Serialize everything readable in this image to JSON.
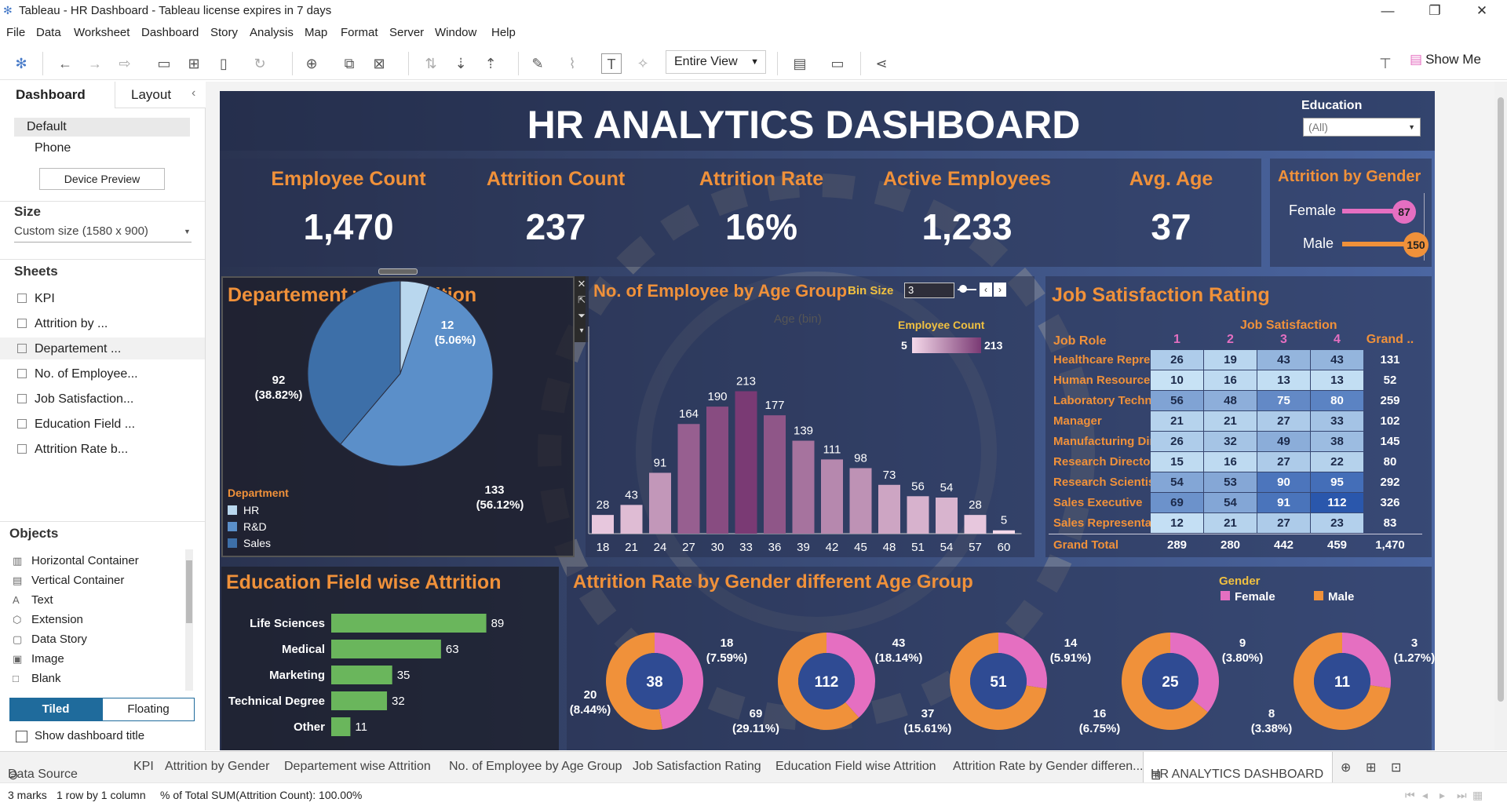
{
  "window": {
    "title": "Tableau - HR Dashboard - Tableau license expires in 7 days"
  },
  "menu": [
    "File",
    "Data",
    "Worksheet",
    "Dashboard",
    "Story",
    "Analysis",
    "Map",
    "Format",
    "Server",
    "Window",
    "Help"
  ],
  "toolbar": {
    "view_mode": "Entire View",
    "show_me": "Show Me"
  },
  "left_panel": {
    "tabs": [
      "Dashboard",
      "Layout"
    ],
    "devices": [
      "Default",
      "Phone"
    ],
    "device_preview": "Device Preview",
    "size_head": "Size",
    "size_value": "Custom size (1580 x 900)",
    "sheets_head": "Sheets",
    "sheets": [
      "KPI",
      "Attrition by ...",
      "Departement ...",
      "No. of Employee...",
      "Job Satisfaction...",
      "Education Field ...",
      "Attrition Rate b..."
    ],
    "objects_head": "Objects",
    "objects": [
      "Horizontal Container",
      "Vertical Container",
      "Text",
      "Extension",
      "Data Story",
      "Image",
      "Blank"
    ],
    "layout_modes": [
      "Tiled",
      "Floating"
    ],
    "show_title": "Show dashboard title"
  },
  "dashboard": {
    "title": "HR ANALYTICS DASHBOARD",
    "education_filter": {
      "label": "Education",
      "value": "(All)"
    },
    "kpis": [
      {
        "label": "Employee Count",
        "value": "1,470"
      },
      {
        "label": "Attrition Count",
        "value": "237"
      },
      {
        "label": "Attrition Rate",
        "value": "16%"
      },
      {
        "label": "Active Employees",
        "value": "1,233"
      },
      {
        "label": "Avg. Age",
        "value": "37"
      }
    ],
    "gender_panel": {
      "title": "Attrition by Gender",
      "rows": [
        {
          "label": "Female",
          "value": 87
        },
        {
          "label": "Male",
          "value": 150
        }
      ],
      "colors": {
        "Female": "#e56fc1",
        "Male": "#f0913a"
      }
    },
    "dept": {
      "title": "Departement wise Attrition",
      "legend_title": "Department",
      "slices": [
        {
          "name": "HR",
          "value": 12,
          "label": "12",
          "pct": "(5.06%)",
          "color": "#b9d7ee"
        },
        {
          "name": "R&D",
          "value": 133,
          "label": "133",
          "pct": "(56.12%)",
          "color": "#5b8fc9"
        },
        {
          "name": "Sales",
          "value": 92,
          "label": "92",
          "pct": "(38.82%)",
          "color": "#3d6fa8"
        }
      ]
    },
    "age": {
      "title": "No. of Employee by Age Group",
      "bin_label": "Bin Size",
      "bin_value": "3",
      "axis_title": "Age (bin)",
      "legend_title": "Employee Count",
      "legend_min": "5",
      "legend_max": "213"
    },
    "job": {
      "title": "Job Satisfaction Rating",
      "col_header": "Job Satisfaction",
      "row_header": "Job Role",
      "cols": [
        "1",
        "2",
        "3",
        "4",
        "Grand .."
      ],
      "rows": [
        {
          "role": "Healthcare Represe..",
          "v": [
            26,
            19,
            43,
            43
          ],
          "t": "131"
        },
        {
          "role": "Human Resources",
          "v": [
            10,
            16,
            13,
            13
          ],
          "t": "52"
        },
        {
          "role": "Laboratory Technici..",
          "v": [
            56,
            48,
            75,
            80
          ],
          "t": "259"
        },
        {
          "role": "Manager",
          "v": [
            21,
            21,
            27,
            33
          ],
          "t": "102"
        },
        {
          "role": "Manufacturing Direc..",
          "v": [
            26,
            32,
            49,
            38
          ],
          "t": "145"
        },
        {
          "role": "Research Director",
          "v": [
            15,
            16,
            27,
            22
          ],
          "t": "80"
        },
        {
          "role": "Research Scientist",
          "v": [
            54,
            53,
            90,
            95
          ],
          "t": "292"
        },
        {
          "role": "Sales Executive",
          "v": [
            69,
            54,
            91,
            112
          ],
          "t": "326"
        },
        {
          "role": "Sales Representative",
          "v": [
            12,
            21,
            27,
            23
          ],
          "t": "83"
        }
      ],
      "total_label": "Grand Total",
      "totals": [
        "289",
        "280",
        "442",
        "459",
        "1,470"
      ]
    },
    "edu": {
      "title": "Education Field wise Attrition",
      "color": "#6ab65c"
    },
    "gender_age": {
      "title": "Attrition Rate by Gender different Age Group",
      "legend_title": "Gender",
      "legend": [
        {
          "name": "Female",
          "color": "#e56fc1"
        },
        {
          "name": "Male",
          "color": "#f0913a"
        }
      ],
      "donuts": [
        {
          "center": "38",
          "female": 18,
          "female_label": "18",
          "female_pct": "(7.59%)",
          "male": 20,
          "male_label": "20",
          "male_pct": "(8.44%)"
        },
        {
          "center": "112",
          "female": 43,
          "female_label": "43",
          "female_pct": "(18.14%)",
          "male": 69,
          "male_label": "69",
          "male_pct": "(29.11%)"
        },
        {
          "center": "51",
          "female": 14,
          "female_label": "14",
          "female_pct": "(5.91%)",
          "male": 37,
          "male_label": "37",
          "male_pct": "(15.61%)"
        },
        {
          "center": "25",
          "female": 9,
          "female_label": "9",
          "female_pct": "(3.80%)",
          "male": 16,
          "male_label": "16",
          "male_pct": "(6.75%)"
        },
        {
          "center": "11",
          "female": 3,
          "female_label": "3",
          "female_pct": "(1.27%)",
          "male": 8,
          "male_label": "8",
          "male_pct": "(3.38%)"
        }
      ]
    }
  },
  "chart_data": [
    {
      "type": "bar",
      "title": "No. of Employee by Age Group",
      "xlabel": "Age (bin)",
      "categories": [
        "18",
        "21",
        "24",
        "27",
        "30",
        "33",
        "36",
        "39",
        "42",
        "45",
        "48",
        "51",
        "54",
        "57",
        "60"
      ],
      "values": [
        28,
        43,
        91,
        164,
        190,
        213,
        177,
        139,
        111,
        98,
        73,
        56,
        54,
        28,
        5
      ],
      "ylim": [
        0,
        230
      ]
    },
    {
      "type": "bar",
      "title": "Education Field wise Attrition",
      "categories": [
        "Life Sciences",
        "Medical",
        "Marketing",
        "Technical Degree",
        "Other"
      ],
      "values": [
        89,
        63,
        35,
        32,
        11
      ],
      "xlim": [
        0,
        100
      ]
    }
  ],
  "sheet_tabs": [
    "Data Source",
    "KPI",
    "Attrition by Gender",
    "Departement wise Attrition",
    "No. of Employee by Age Group",
    "Job Satisfaction Rating",
    "Education Field wise Attrition",
    "Attrition Rate by Gender differen...",
    "HR ANALYTICS DASHBOARD"
  ],
  "status": {
    "marks": "3 marks",
    "rows": "1 row by 1 column",
    "agg": "% of Total SUM(Attrition Count): 100.00%"
  }
}
